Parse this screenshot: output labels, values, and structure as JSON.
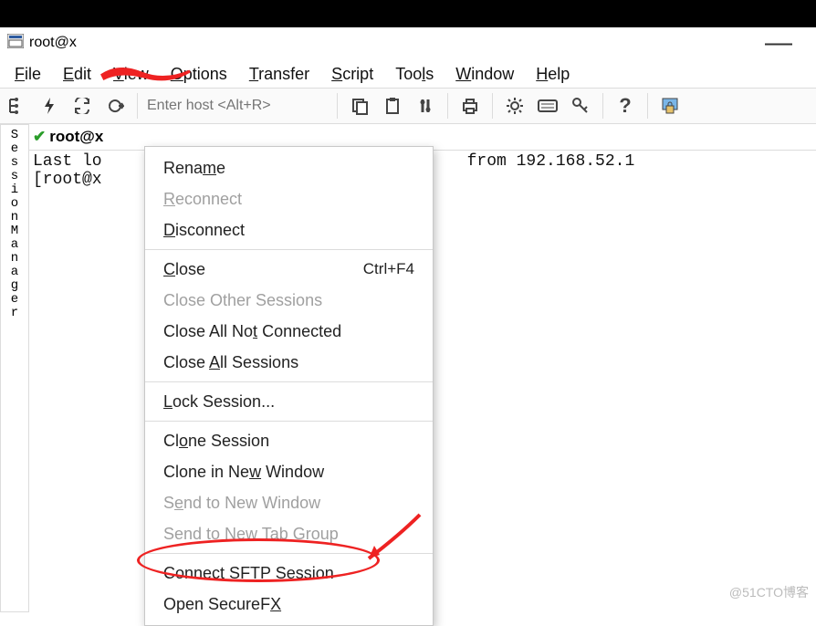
{
  "titlebar": {
    "title": "root@x"
  },
  "menubar": {
    "file": "File",
    "edit": "Edit",
    "view": "View",
    "options": "Options",
    "transfer": "Transfer",
    "script": "Script",
    "tools": "Tools",
    "window": "Window",
    "help": "Help"
  },
  "toolbar": {
    "host_placeholder": "Enter host <Alt+R>",
    "icons": {
      "connect": "tree-icon",
      "quick": "bolt-icon",
      "reconnect": "reconnect-icon",
      "disconnect": "disconnect-icon",
      "copy": "copy-icon",
      "paste": "paste-icon",
      "find": "find-icon",
      "print": "print-icon",
      "settings": "gear-icon",
      "keyboard": "keyboard-icon",
      "key": "key-icon",
      "help": "help-icon",
      "lock": "lock-icon"
    }
  },
  "sidebar": {
    "label_chars": [
      "S",
      "e",
      "s",
      "s",
      "i",
      "o",
      "n",
      " ",
      "M",
      "a",
      "n",
      "a",
      "g",
      "e",
      "r"
    ]
  },
  "tab": {
    "label": "root@x"
  },
  "terminal": {
    "line1_left": "Last lo",
    "line1_right": "from 192.168.52.1",
    "line2_left": "[root@x"
  },
  "context_menu": {
    "rename": "Rename",
    "reconnect": "Reconnect",
    "disconnect": "Disconnect",
    "close": "Close",
    "close_shortcut": "Ctrl+F4",
    "close_other": "Close Other Sessions",
    "close_not_connected": "Close All Not Connected",
    "close_all": "Close All Sessions",
    "lock": "Lock Session...",
    "clone": "Clone Session",
    "clone_window": "Clone in New Window",
    "send_window": "Send to New Window",
    "send_tabgroup": "Send to New Tab Group",
    "sftp": "Connect SFTP Session",
    "securefx": "Open SecureFX"
  },
  "watermark": "@51CTO博客"
}
